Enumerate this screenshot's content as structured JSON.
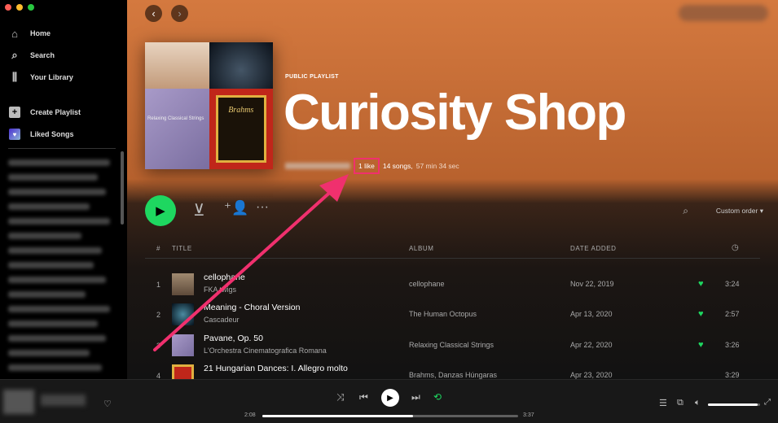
{
  "sidebar": {
    "items": [
      {
        "label": "Home",
        "icon": "home-icon"
      },
      {
        "label": "Search",
        "icon": "search-icon"
      },
      {
        "label": "Your Library",
        "icon": "library-icon"
      }
    ],
    "create_playlist": "Create Playlist",
    "liked_songs": "Liked Songs"
  },
  "playlist": {
    "type": "PUBLIC PLAYLIST",
    "title": "Curiosity Shop",
    "likes": "1 like",
    "songs": "14 songs,",
    "duration": "57 min 34 sec",
    "cover_texts": [
      "Relaxing Classical Strings",
      "Brahms"
    ]
  },
  "actions": {
    "sort": "Custom order"
  },
  "table": {
    "headers": {
      "num": "#",
      "title": "TITLE",
      "album": "ALBUM",
      "date": "DATE ADDED"
    },
    "rows": [
      {
        "num": "1",
        "title": "cellophane",
        "artist": "FKA twigs",
        "album": "cellophane",
        "date": "Nov 22, 2019",
        "liked": true,
        "duration": "3:24"
      },
      {
        "num": "2",
        "title": "Meaning - Choral Version",
        "artist": "Cascadeur",
        "album": "The Human Octopus",
        "date": "Apr 13, 2020",
        "liked": true,
        "duration": "2:57"
      },
      {
        "num": "3",
        "title": "Pavane, Op. 50",
        "artist": "L'Orchestra Cinematografica Romana",
        "album": "Relaxing Classical Strings",
        "date": "Apr 22, 2020",
        "liked": true,
        "duration": "3:26"
      },
      {
        "num": "4",
        "title": "21 Hungarian Dances: I. Allegro molto",
        "artist": "",
        "album": "Brahms, Danzas Húngaras",
        "date": "Apr 23, 2020",
        "liked": false,
        "duration": "3:29"
      }
    ]
  },
  "player": {
    "elapsed": "2:08",
    "total": "3:37",
    "progress": 0.59,
    "volume": 0.95
  },
  "colors": {
    "accent": "#1ed760",
    "highlight": "#f0306e",
    "header": "#d4793f"
  }
}
